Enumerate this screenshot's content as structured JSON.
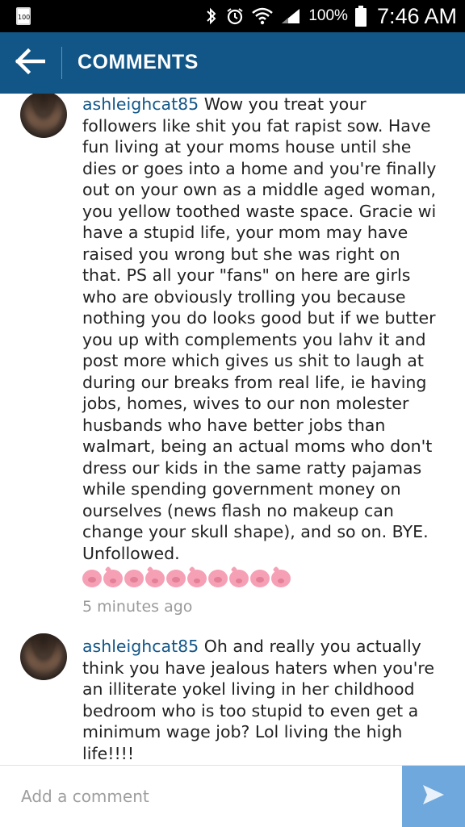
{
  "status_bar": {
    "battery_badge": "100",
    "battery_percent": "100%",
    "time": "7:46 AM"
  },
  "header": {
    "title": "COMMENTS"
  },
  "comments": [
    {
      "username": "ashleighcat85",
      "text": " Wow you treat your followers like shit you fat rapist sow. Have fun living at your moms house until she dies or goes into a home and you're finally out on your own as a middle aged woman, you yellow toothed waste space. Gracie wi have a stupid life, your mom may have raised you wrong but she was right on that. PS all your \"fans\" on here are girls who are obviously trolling you because nothing you do looks good but if we butter you up with complements you lahv it and post more which gives us shit to laugh at during our breaks from real life, ie having jobs, homes, wives to our non molester husbands who have better jobs than walmart, being an actual moms who don't dress our kids in the same ratty pajamas while spending government money on ourselves (news flash no makeup can change your skull shape), and so on. BYE. Unfollowed.",
      "emoji_names": [
        "pig-nose",
        "pig-face",
        "pig-nose",
        "pig-face",
        "pig-nose",
        "pig-face",
        "pig-nose",
        "pig-face",
        "pig-nose",
        "pig-face"
      ],
      "timestamp": "5 minutes ago"
    },
    {
      "username": "ashleighcat85",
      "text": " Oh and really you actually think you have jealous haters when you're an illiterate yokel living in her childhood bedroom who is too stupid to even get a minimum wage job? Lol living the high life!!!!"
    }
  ],
  "input": {
    "placeholder": "Add a comment"
  },
  "colors": {
    "header_bg": "#125688",
    "username": "#125688",
    "send_button": "#6fa8dc"
  },
  "icons": {
    "back": "back-arrow-icon",
    "send": "send-icon"
  }
}
